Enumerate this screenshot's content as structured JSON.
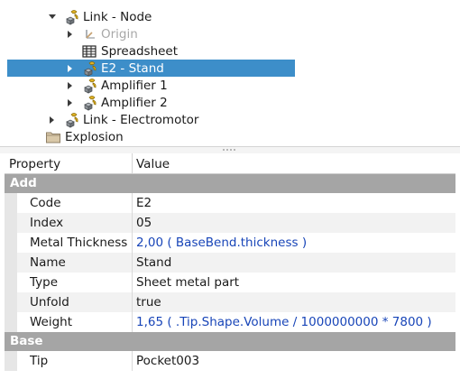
{
  "tree": {
    "items": [
      {
        "label": "Link - Node",
        "icon": "link-icon",
        "expander": "expanded",
        "state": "normal"
      },
      {
        "label": "Origin",
        "icon": "origin-icon",
        "expander": "collapsed",
        "state": "disabled"
      },
      {
        "label": "Spreadsheet",
        "icon": "spreadsheet-icon",
        "expander": "none",
        "state": "normal"
      },
      {
        "label": "E2 - Stand",
        "icon": "link-icon",
        "expander": "collapsed",
        "state": "selected"
      },
      {
        "label": "Amplifier 1",
        "icon": "link-icon",
        "expander": "collapsed",
        "state": "normal"
      },
      {
        "label": "Amplifier 2",
        "icon": "link-icon",
        "expander": "collapsed",
        "state": "normal"
      },
      {
        "label": "Link - Electromotor",
        "icon": "link-icon",
        "expander": "collapsed",
        "state": "normal"
      },
      {
        "label": "Explosion",
        "icon": "folder-icon",
        "expander": "none",
        "state": "normal"
      }
    ],
    "selection_color": "#3d8ec9"
  },
  "properties": {
    "header": {
      "property": "Property",
      "value": "Value"
    },
    "groups": [
      {
        "name": "Add",
        "rows": [
          {
            "name": "Code",
            "value": "E2",
            "is_expression": false
          },
          {
            "name": "Index",
            "value": "05",
            "is_expression": false
          },
          {
            "name": "Metal Thickness",
            "value": "2,00  ( BaseBend.thickness )",
            "is_expression": true
          },
          {
            "name": "Name",
            "value": "Stand",
            "is_expression": false
          },
          {
            "name": "Type",
            "value": "Sheet metal part",
            "is_expression": false
          },
          {
            "name": "Unfold",
            "value": "true",
            "is_expression": false
          },
          {
            "name": "Weight",
            "value": "1,65  ( .Tip.Shape.Volume / 1000000000 * 7800 )",
            "is_expression": true
          }
        ]
      },
      {
        "name": "Base",
        "rows": [
          {
            "name": "Tip",
            "value": "Pocket003",
            "is_expression": false
          }
        ]
      }
    ],
    "group_color": "#a5a5a5",
    "expression_color": "#1845b8"
  }
}
